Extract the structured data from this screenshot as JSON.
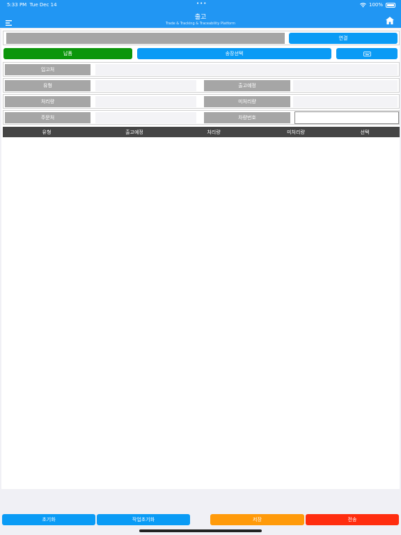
{
  "status": {
    "time": "5:33 PM",
    "date": "Tue Dec 14",
    "battery": "100%"
  },
  "nav": {
    "title": "출고",
    "subtitle": "Trade & Tracking & Traceability Platform"
  },
  "connect": {
    "label": "연결"
  },
  "actions": {
    "deliver": "납품",
    "invoice_select": "송장선택"
  },
  "fields": {
    "receiver": "입고처",
    "type": "유형",
    "scheduled": "출고예정",
    "processed": "처리량",
    "unprocessed": "미처리량",
    "orderer": "주문처",
    "vehicle_no": "차량번호"
  },
  "table": {
    "columns": [
      "유형",
      "출고예정",
      "처리량",
      "미처리량",
      "선택"
    ]
  },
  "bottom": {
    "reset": "초기화",
    "work_reset": "작업초기화",
    "save": "저장",
    "send": "전송"
  }
}
